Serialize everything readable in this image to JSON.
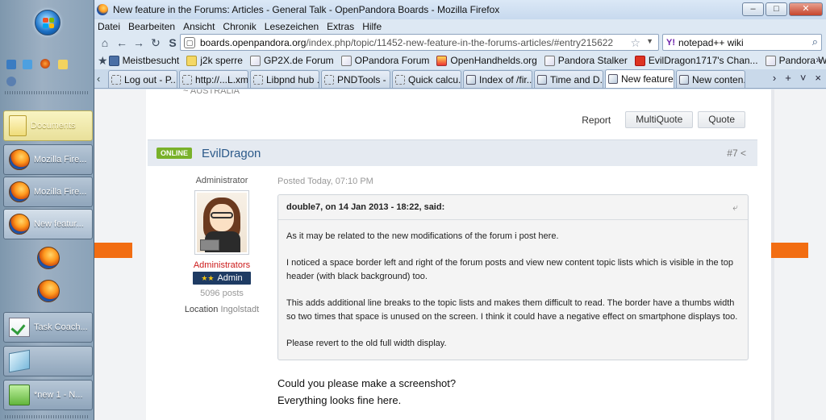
{
  "window": {
    "title": "New feature in the Forums: Articles - General Talk - OpenPandora Boards - Mozilla Firefox",
    "controls": [
      "–",
      "□",
      "✕"
    ]
  },
  "menu": [
    "Datei",
    "Bearbeiten",
    "Ansicht",
    "Chronik",
    "Lesezeichen",
    "Extras",
    "Hilfe"
  ],
  "nav": {
    "url_host": "boards.openpandora.org",
    "url_path": "/index.php/topic/11452-new-feature-in-the-forums-articles/#entry215622",
    "search_value": "notepad++ wiki",
    "search_engine": "Y!"
  },
  "bookmarks": [
    "Meistbesucht",
    "j2k sperre",
    "GP2X.de Forum",
    "OPandora Forum",
    "OpenHandhelds.org",
    "Pandora Stalker",
    "EvilDragon1717's Chan...",
    "Pandora Wiki"
  ],
  "tabs": [
    "Log out - P...",
    "http://...L.xml",
    "Libpnd hub ...",
    "PNDTools - ...",
    "Quick calcu...",
    "Index of /fir...",
    "Time and D...",
    "New feature...",
    "New conten..."
  ],
  "taskbar": {
    "items": [
      "Documents",
      "Mozilla Fire...",
      "Mozilla Fire...",
      "New featur...",
      "Task Coach...",
      "",
      "*new 1 - N..."
    ]
  },
  "post": {
    "prev_location": "~ AUSTRALIA",
    "actions": {
      "report": "Report",
      "multiquote": "MultiQuote",
      "quote": "Quote"
    },
    "online_badge": "ONLINE",
    "author": "EvilDragon",
    "number": "#7",
    "author_title": "Administrator",
    "group": "Administrators",
    "badge": "Admin",
    "badge_stars": "★★",
    "post_count": "5096 posts",
    "location_label": "Location",
    "location_value": "Ingolstadt",
    "posted": "Posted Today, 07:10 PM",
    "quote_header": "double7, on 14 Jan 2013 - 18:22, said:",
    "quote_paragraphs": [
      "As it may be related to the new modifications of the forum i post here.",
      "I noticed a space border left and right of the forum posts and view new content topic lists which is visible in the top header (with black background) too.",
      "This adds additional line breaks to the topic lists and makes them difficult to read. The border have a thumbs width so two times that space is unused on the screen. I think it could have a negative effect on smartphone displays too.",
      "Please revert to the old full width display."
    ],
    "reply_lines": [
      "Could you please make a screenshot?",
      "Everything looks fine here."
    ]
  },
  "colors": {
    "accent_orange": "#f26d12",
    "online_green": "#79b12a",
    "author_blue": "#2c5a8a",
    "admin_red": "#cc1b1b"
  }
}
